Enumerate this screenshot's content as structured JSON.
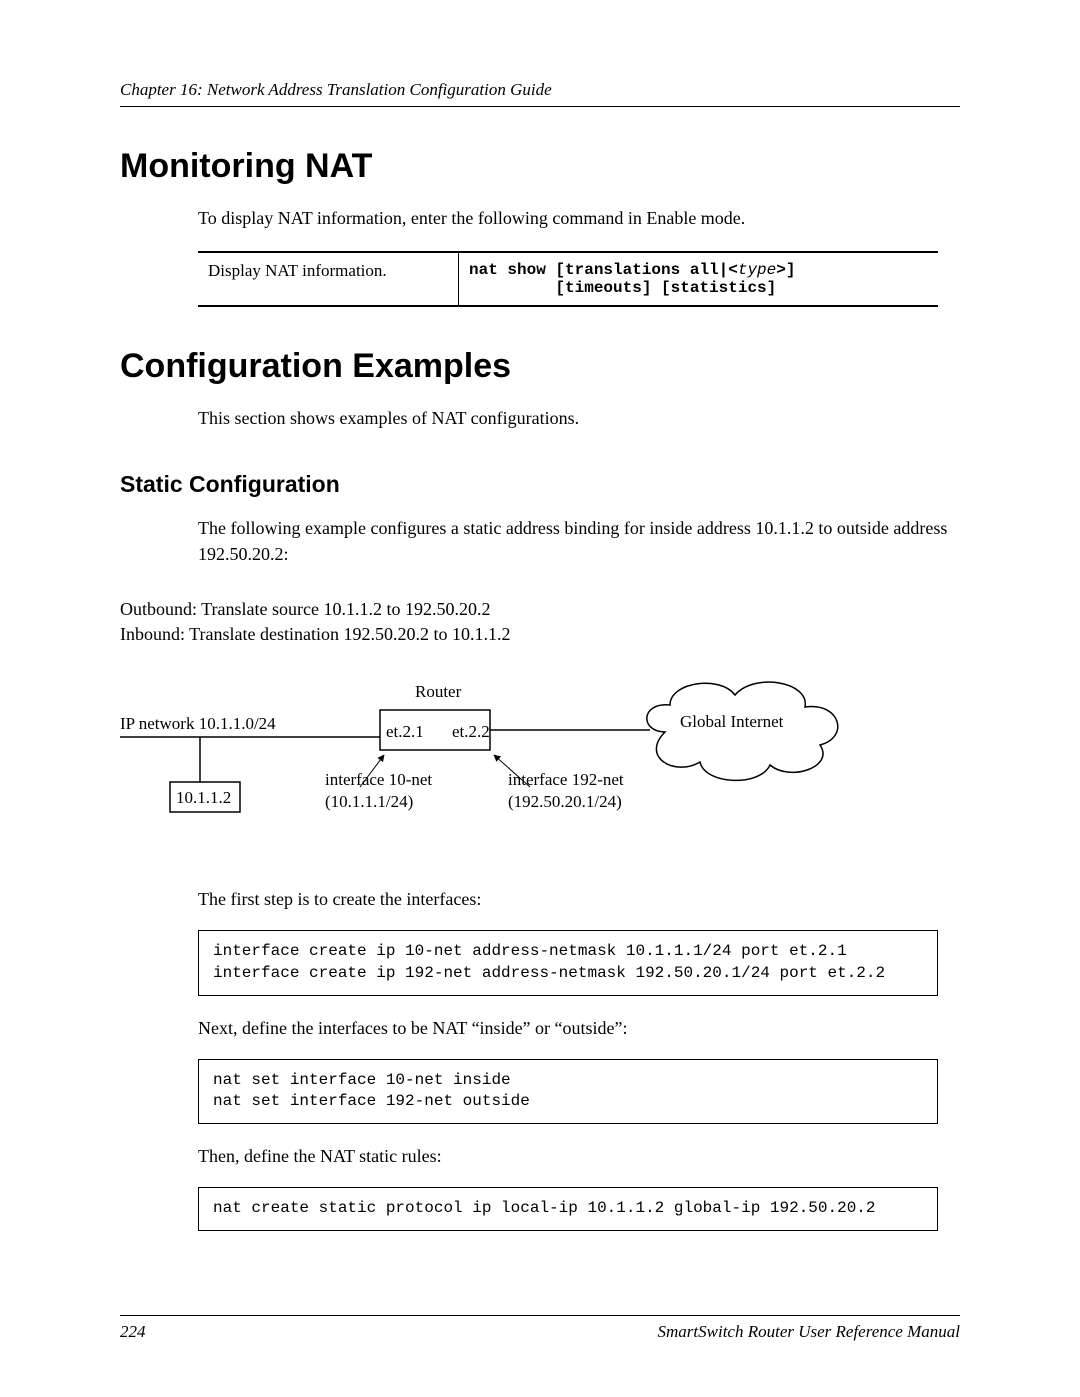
{
  "header": {
    "chapter": "Chapter 16: Network Address Translation Configuration Guide"
  },
  "sections": {
    "monitoring": {
      "title": "Monitoring NAT",
      "intro": "To display NAT information, enter the following command in Enable mode.",
      "table": {
        "desc": "Display NAT information.",
        "cmd_prefix": "nat show [translations all|<",
        "cmd_param": "type",
        "cmd_suffix": ">]\n         [timeouts] [statistics]"
      }
    },
    "config_examples": {
      "title": "Configuration Examples",
      "intro": "This section shows examples of NAT configurations.",
      "static": {
        "title": "Static Configuration",
        "intro": "The following example configures a static address binding for inside address 10.1.1.2 to outside address 192.50.20.2:",
        "diagram_caption_line1": "Outbound: Translate source 10.1.1.2 to 192.50.20.2",
        "diagram_caption_line2": "Inbound: Translate destination 192.50.20.2 to 10.1.1.2",
        "diagram": {
          "ip_network": "IP network 10.1.1.0/24",
          "host": "10.1.1.2",
          "router_label": "Router",
          "port_left": "et.2.1",
          "port_right": "et.2.2",
          "iface10_label": "interface 10-net",
          "iface10_addr": "(10.1.1.1/24)",
          "iface192_label": "interface 192-net",
          "iface192_addr": "(192.50.20.1/24)",
          "cloud": "Global Internet"
        },
        "step1_text": "The first step is to create the interfaces:",
        "code1": "interface create ip 10-net address-netmask 10.1.1.1/24 port et.2.1\ninterface create ip 192-net address-netmask 192.50.20.1/24 port et.2.2",
        "step2_text": "Next, define the interfaces to be NAT “inside” or “outside”:",
        "code2": "nat set interface 10-net inside\nnat set interface 192-net outside",
        "step3_text": "Then, define the NAT static rules:",
        "code3": "nat create static protocol ip local-ip 10.1.1.2 global-ip 192.50.20.2"
      }
    }
  },
  "footer": {
    "page": "224",
    "manual": "SmartSwitch Router User Reference Manual"
  }
}
